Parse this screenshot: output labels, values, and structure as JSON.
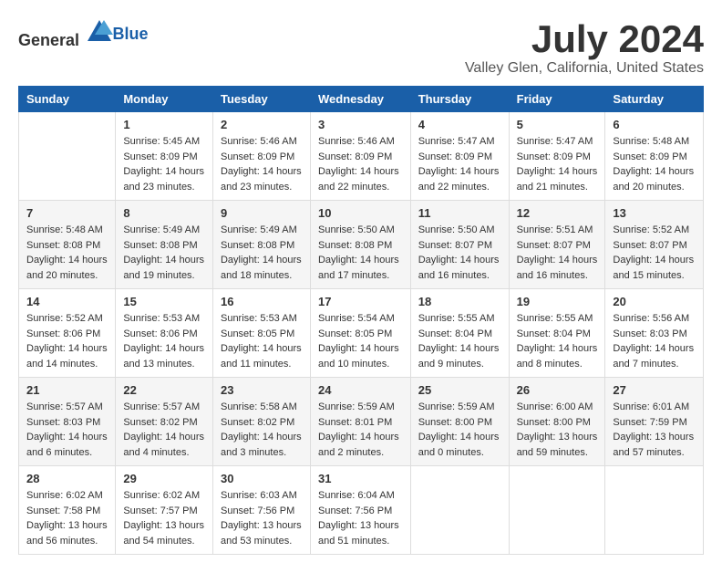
{
  "header": {
    "logo_general": "General",
    "logo_blue": "Blue",
    "month_title": "July 2024",
    "location": "Valley Glen, California, United States"
  },
  "calendar": {
    "days_of_week": [
      "Sunday",
      "Monday",
      "Tuesday",
      "Wednesday",
      "Thursday",
      "Friday",
      "Saturday"
    ],
    "weeks": [
      [
        {
          "day": "",
          "info": ""
        },
        {
          "day": "1",
          "info": "Sunrise: 5:45 AM\nSunset: 8:09 PM\nDaylight: 14 hours\nand 23 minutes."
        },
        {
          "day": "2",
          "info": "Sunrise: 5:46 AM\nSunset: 8:09 PM\nDaylight: 14 hours\nand 23 minutes."
        },
        {
          "day": "3",
          "info": "Sunrise: 5:46 AM\nSunset: 8:09 PM\nDaylight: 14 hours\nand 22 minutes."
        },
        {
          "day": "4",
          "info": "Sunrise: 5:47 AM\nSunset: 8:09 PM\nDaylight: 14 hours\nand 22 minutes."
        },
        {
          "day": "5",
          "info": "Sunrise: 5:47 AM\nSunset: 8:09 PM\nDaylight: 14 hours\nand 21 minutes."
        },
        {
          "day": "6",
          "info": "Sunrise: 5:48 AM\nSunset: 8:09 PM\nDaylight: 14 hours\nand 20 minutes."
        }
      ],
      [
        {
          "day": "7",
          "info": "Sunrise: 5:48 AM\nSunset: 8:08 PM\nDaylight: 14 hours\nand 20 minutes."
        },
        {
          "day": "8",
          "info": "Sunrise: 5:49 AM\nSunset: 8:08 PM\nDaylight: 14 hours\nand 19 minutes."
        },
        {
          "day": "9",
          "info": "Sunrise: 5:49 AM\nSunset: 8:08 PM\nDaylight: 14 hours\nand 18 minutes."
        },
        {
          "day": "10",
          "info": "Sunrise: 5:50 AM\nSunset: 8:08 PM\nDaylight: 14 hours\nand 17 minutes."
        },
        {
          "day": "11",
          "info": "Sunrise: 5:50 AM\nSunset: 8:07 PM\nDaylight: 14 hours\nand 16 minutes."
        },
        {
          "day": "12",
          "info": "Sunrise: 5:51 AM\nSunset: 8:07 PM\nDaylight: 14 hours\nand 16 minutes."
        },
        {
          "day": "13",
          "info": "Sunrise: 5:52 AM\nSunset: 8:07 PM\nDaylight: 14 hours\nand 15 minutes."
        }
      ],
      [
        {
          "day": "14",
          "info": "Sunrise: 5:52 AM\nSunset: 8:06 PM\nDaylight: 14 hours\nand 14 minutes."
        },
        {
          "day": "15",
          "info": "Sunrise: 5:53 AM\nSunset: 8:06 PM\nDaylight: 14 hours\nand 13 minutes."
        },
        {
          "day": "16",
          "info": "Sunrise: 5:53 AM\nSunset: 8:05 PM\nDaylight: 14 hours\nand 11 minutes."
        },
        {
          "day": "17",
          "info": "Sunrise: 5:54 AM\nSunset: 8:05 PM\nDaylight: 14 hours\nand 10 minutes."
        },
        {
          "day": "18",
          "info": "Sunrise: 5:55 AM\nSunset: 8:04 PM\nDaylight: 14 hours\nand 9 minutes."
        },
        {
          "day": "19",
          "info": "Sunrise: 5:55 AM\nSunset: 8:04 PM\nDaylight: 14 hours\nand 8 minutes."
        },
        {
          "day": "20",
          "info": "Sunrise: 5:56 AM\nSunset: 8:03 PM\nDaylight: 14 hours\nand 7 minutes."
        }
      ],
      [
        {
          "day": "21",
          "info": "Sunrise: 5:57 AM\nSunset: 8:03 PM\nDaylight: 14 hours\nand 6 minutes."
        },
        {
          "day": "22",
          "info": "Sunrise: 5:57 AM\nSunset: 8:02 PM\nDaylight: 14 hours\nand 4 minutes."
        },
        {
          "day": "23",
          "info": "Sunrise: 5:58 AM\nSunset: 8:02 PM\nDaylight: 14 hours\nand 3 minutes."
        },
        {
          "day": "24",
          "info": "Sunrise: 5:59 AM\nSunset: 8:01 PM\nDaylight: 14 hours\nand 2 minutes."
        },
        {
          "day": "25",
          "info": "Sunrise: 5:59 AM\nSunset: 8:00 PM\nDaylight: 14 hours\nand 0 minutes."
        },
        {
          "day": "26",
          "info": "Sunrise: 6:00 AM\nSunset: 8:00 PM\nDaylight: 13 hours\nand 59 minutes."
        },
        {
          "day": "27",
          "info": "Sunrise: 6:01 AM\nSunset: 7:59 PM\nDaylight: 13 hours\nand 57 minutes."
        }
      ],
      [
        {
          "day": "28",
          "info": "Sunrise: 6:02 AM\nSunset: 7:58 PM\nDaylight: 13 hours\nand 56 minutes."
        },
        {
          "day": "29",
          "info": "Sunrise: 6:02 AM\nSunset: 7:57 PM\nDaylight: 13 hours\nand 54 minutes."
        },
        {
          "day": "30",
          "info": "Sunrise: 6:03 AM\nSunset: 7:56 PM\nDaylight: 13 hours\nand 53 minutes."
        },
        {
          "day": "31",
          "info": "Sunrise: 6:04 AM\nSunset: 7:56 PM\nDaylight: 13 hours\nand 51 minutes."
        },
        {
          "day": "",
          "info": ""
        },
        {
          "day": "",
          "info": ""
        },
        {
          "day": "",
          "info": ""
        }
      ]
    ]
  }
}
